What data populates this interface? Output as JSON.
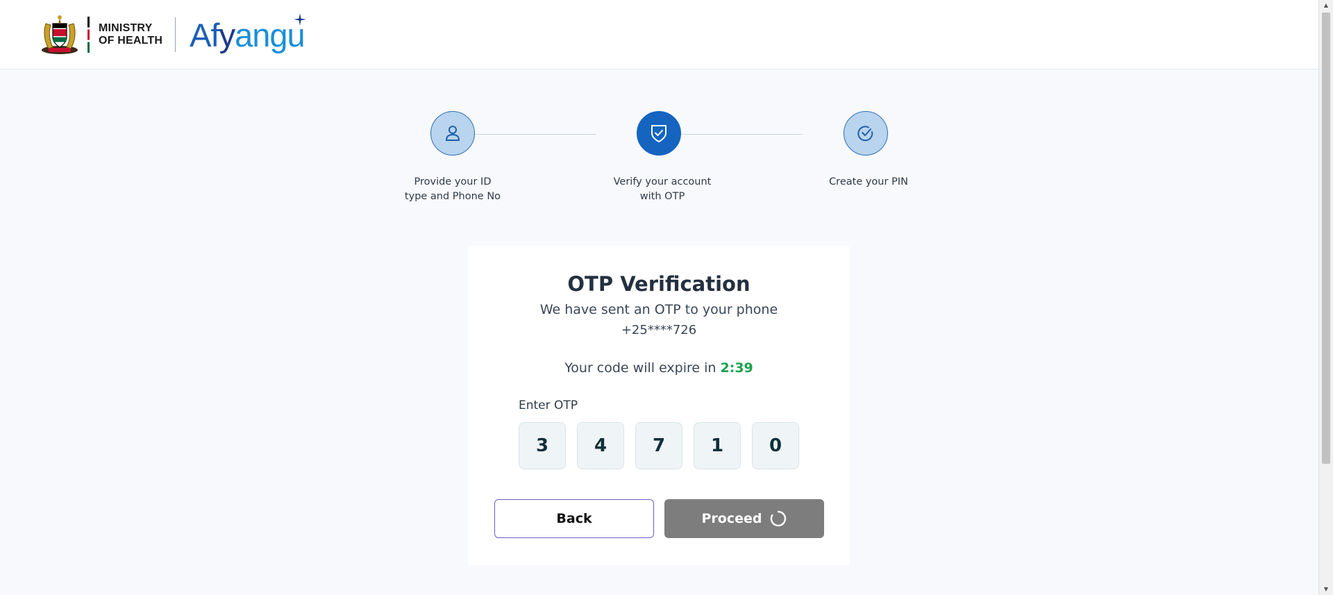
{
  "header": {
    "ministry_line1": "MINISTRY",
    "ministry_line2": "OF HEALTH",
    "brand": {
      "part1": "Af",
      "part2": "y",
      "part3": "angu"
    }
  },
  "stepper": {
    "steps": [
      {
        "label_line1": "Provide your ID",
        "label_line2": "type and Phone No",
        "icon": "user-icon",
        "state": "inactive"
      },
      {
        "label_line1": "Verify your account",
        "label_line2": "with OTP",
        "icon": "shield-check-icon",
        "state": "active"
      },
      {
        "label_line1": "Create your PIN",
        "label_line2": "",
        "icon": "check-circle-icon",
        "state": "inactive"
      }
    ]
  },
  "otp_card": {
    "title": "OTP Verification",
    "subtitle": "We have sent an OTP to your phone",
    "phone": "+25****726",
    "expiry_prefix": "Your code will expire in ",
    "timer": "2:39",
    "otp_label": "Enter OTP",
    "otp_digits": [
      "3",
      "4",
      "7",
      "1",
      "0"
    ],
    "back_label": "Back",
    "proceed_label": "Proceed"
  },
  "colors": {
    "primary": "#1565c0",
    "step_inactive": "#b9d4ee",
    "timer": "#18a24a",
    "proceed_disabled": "#7d7d7d",
    "back_border": "#6f5cc7"
  }
}
